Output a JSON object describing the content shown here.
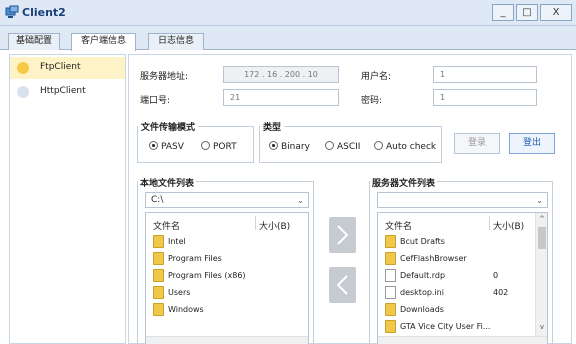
{
  "window": {
    "title": "Client2",
    "min_label": "_",
    "max_label": "□",
    "close_label": "X"
  },
  "tabs": [
    {
      "label": "基础配置",
      "active": false
    },
    {
      "label": "客户端信息",
      "active": true
    },
    {
      "label": "日志信息",
      "active": false
    }
  ],
  "sidebar": {
    "items": [
      {
        "label": "FtpClient",
        "selected": true
      },
      {
        "label": "HttpClient",
        "selected": false
      }
    ]
  },
  "connection": {
    "server_label": "服务器地址:",
    "server_value": "172 . 16 . 200 . 10",
    "user_label": "用户名:",
    "user_value": "1",
    "port_label": "端口号:",
    "port_value": "21",
    "password_label": "密码:",
    "password_value": "1"
  },
  "transfer_mode": {
    "title": "文件传输模式",
    "options": [
      "PASV",
      "PORT"
    ],
    "selected": "PASV"
  },
  "type": {
    "title": "类型",
    "options": [
      "Binary",
      "ASCII",
      "Auto check"
    ],
    "selected": "Binary"
  },
  "buttons": {
    "login": "登录",
    "logout": "登出"
  },
  "local": {
    "title": "本地文件列表",
    "path": "C:\\",
    "col_name": "文件名",
    "col_size": "大小(B)",
    "files": [
      {
        "name": "Intel",
        "size": "",
        "kind": "folder"
      },
      {
        "name": "Program Files",
        "size": "",
        "kind": "folder"
      },
      {
        "name": "Program Files (x86)",
        "size": "",
        "kind": "folder"
      },
      {
        "name": "Users",
        "size": "",
        "kind": "folder"
      },
      {
        "name": "Windows",
        "size": "",
        "kind": "folder"
      }
    ]
  },
  "server": {
    "title": "服务器文件列表",
    "path": "",
    "col_name": "文件名",
    "col_size": "大小(B)",
    "files": [
      {
        "name": "Bcut Drafts",
        "size": "",
        "kind": "folder"
      },
      {
        "name": "CefFlashBrowser",
        "size": "",
        "kind": "folder"
      },
      {
        "name": "Default.rdp",
        "size": "0",
        "kind": "file"
      },
      {
        "name": "desktop.ini",
        "size": "402",
        "kind": "file"
      },
      {
        "name": "Downloads",
        "size": "",
        "kind": "folder"
      },
      {
        "name": "GTA Vice City User Fi...",
        "size": "",
        "kind": "folder"
      }
    ]
  },
  "icons": {
    "app": "network-client-icon",
    "folder": "folder-icon",
    "file": "file-icon",
    "upload": "chevron-right-icon",
    "download": "chevron-left-icon"
  },
  "colors": {
    "titlebar": "#dfe9f5",
    "selected_item": "#fdf3c7",
    "accent": "#1a5fb4"
  }
}
